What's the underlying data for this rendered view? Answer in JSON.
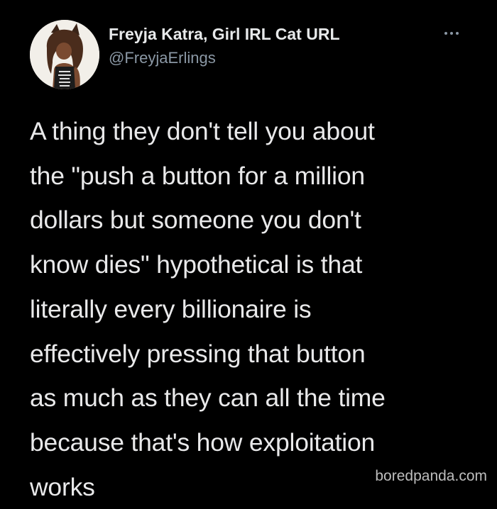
{
  "tweet": {
    "author": {
      "display_name": "Freyja Katra, Girl IRL Cat URL",
      "handle": "@FreyjaErlings",
      "avatar_icon": "avatar-cat-girl-illustration"
    },
    "more_icon": "more-dots-icon",
    "text_lines": [
      "A thing they don't tell you about",
      "the \"push a button for a million",
      "dollars but someone you don't",
      "know dies\" hypothetical is that",
      "literally every billionaire is",
      "effectively pressing that button",
      "as much as they can all the time",
      "because that's how exploitation",
      "works"
    ]
  },
  "watermark": "boredpanda.com",
  "colors": {
    "background": "#000000",
    "primary_text": "#e7e9ea",
    "secondary_text": "#8b98a5"
  }
}
